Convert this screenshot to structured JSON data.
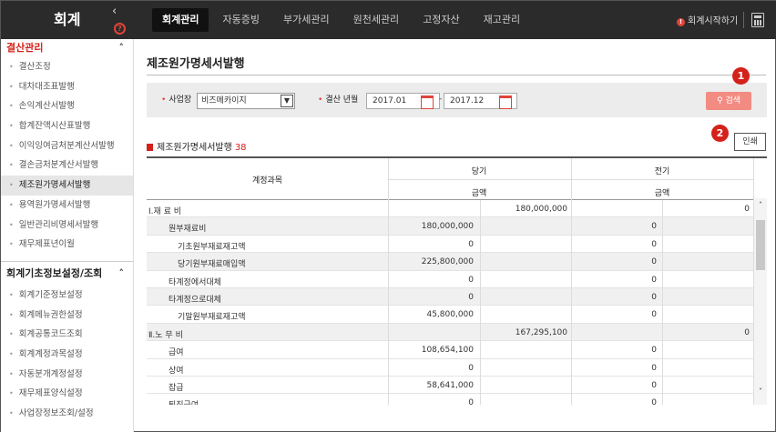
{
  "app": {
    "logo": "회계"
  },
  "topnav": {
    "items": [
      "회계관리",
      "자동증빙",
      "부가세관리",
      "원천세관리",
      "고정자산",
      "재고관리"
    ],
    "active_index": 0,
    "start_label": "회계시작하기"
  },
  "sidebar": {
    "section1": {
      "title": "결산관리",
      "items": [
        "결산조정",
        "대차대조표발행",
        "손익계산서발행",
        "합계잔액시산표발행",
        "이익잉여금처분계산서발행",
        "결손금처분계산서발행",
        "제조원가명세서발행",
        "용역원가명세서발행",
        "일반관리비명세서발행",
        "재무제표년이월"
      ],
      "active_index": 6
    },
    "section2": {
      "title": "회계기초정보설정/조회",
      "items": [
        "회계기준정보설정",
        "회계메뉴권한설정",
        "회계공통코드조회",
        "회계계정과목설정",
        "자동분개계정설정",
        "재무제표양식설정",
        "사업장정보조회/설정"
      ]
    }
  },
  "page": {
    "title": "제조원가명세서발행"
  },
  "filters": {
    "business_label": "사업장",
    "business_value": "비즈메카이지",
    "period_label": "결산 년월",
    "from": "2017.01",
    "to": "2017.12",
    "dash": "-",
    "search_label": "검색",
    "search_icon": "magnifier-icon"
  },
  "badges": {
    "one": "1",
    "two": "2"
  },
  "print_label": "인쇄",
  "section": {
    "title": "제조원가명세서발행",
    "count": "38"
  },
  "grid": {
    "account_header": "계정과목",
    "current_header": "당기",
    "prior_header": "전기",
    "amount_header": "금액",
    "rows": [
      {
        "account": "Ⅰ.재 료 비",
        "c1": "",
        "c2": "180,000,000",
        "p1": "",
        "p2": "0",
        "grey": false
      },
      {
        "account": "원부재료비",
        "c1": "180,000,000",
        "c2": "",
        "p1": "0",
        "p2": "",
        "grey": true
      },
      {
        "account": "기초원부재료재고액",
        "c1": "0",
        "c2": "",
        "p1": "0",
        "p2": "",
        "grey": false
      },
      {
        "account": "당기원부재료매입액",
        "c1": "225,800,000",
        "c2": "",
        "p1": "0",
        "p2": "",
        "grey": true
      },
      {
        "account": "타계정에서대체",
        "c1": "0",
        "c2": "",
        "p1": "0",
        "p2": "",
        "grey": false
      },
      {
        "account": "타계정으로대체",
        "c1": "0",
        "c2": "",
        "p1": "0",
        "p2": "",
        "grey": true
      },
      {
        "account": "기말원부재료재고액",
        "c1": "45,800,000",
        "c2": "",
        "p1": "0",
        "p2": "",
        "grey": false
      },
      {
        "account": "Ⅱ.노 무 비",
        "c1": "",
        "c2": "167,295,100",
        "p1": "",
        "p2": "0",
        "grey": true
      },
      {
        "account": "급여",
        "c1": "108,654,100",
        "c2": "",
        "p1": "0",
        "p2": "",
        "grey": false
      },
      {
        "account": "상여",
        "c1": "0",
        "c2": "",
        "p1": "0",
        "p2": "",
        "grey": false
      },
      {
        "account": "잡급",
        "c1": "58,641,000",
        "c2": "",
        "p1": "0",
        "p2": "",
        "grey": false
      },
      {
        "account": "퇴직급여",
        "c1": "0",
        "c2": "",
        "p1": "0",
        "p2": "",
        "grey": false
      }
    ]
  }
}
